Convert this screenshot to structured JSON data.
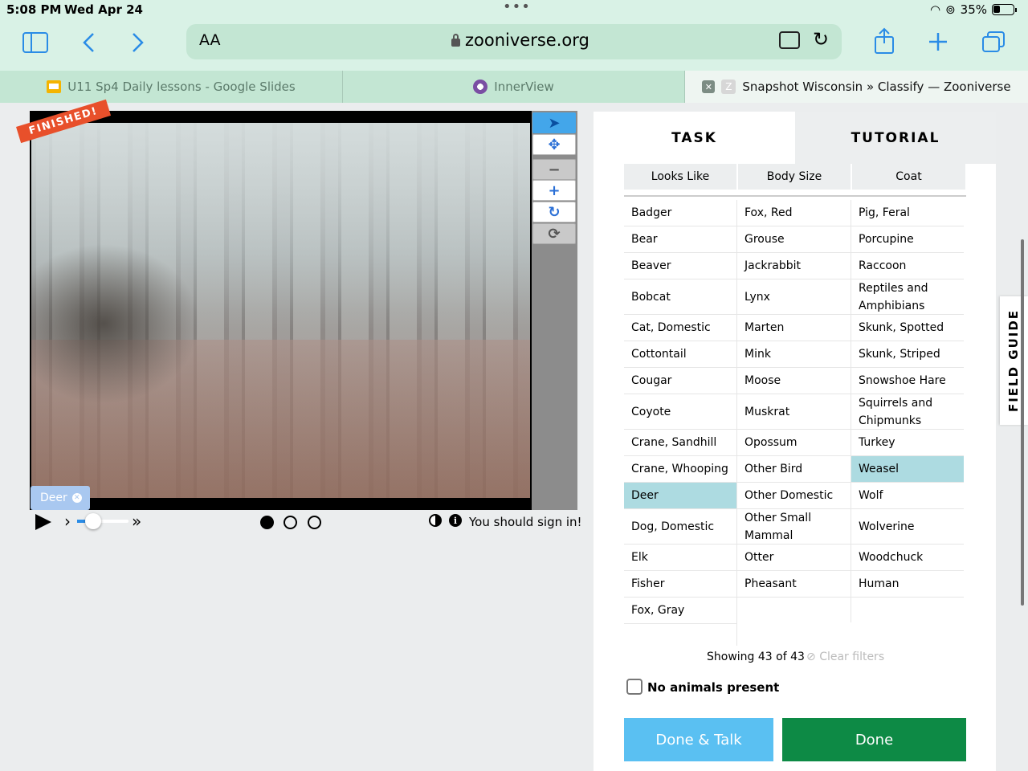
{
  "status_bar": {
    "time": "5:08 PM",
    "date": "Wed Apr 24",
    "battery": "35%"
  },
  "browser": {
    "aa_label": "AA",
    "url": "zooniverse.org",
    "tabs": [
      {
        "label": "U11 Sp4 Daily lessons - Google Slides"
      },
      {
        "label": "InnerView"
      },
      {
        "label": "Snapshot Wisconsin » Classify — Zooniverse"
      }
    ]
  },
  "viewer": {
    "finished_banner": "FINISHED!",
    "selected_chip": "Deer",
    "frame_count": 3,
    "current_frame": 1,
    "sign_in_text": "You should sign in!",
    "playback_slider": 0.2
  },
  "panel": {
    "tabs": {
      "task": "TASK",
      "tutorial": "TUTORIAL"
    },
    "filters": {
      "looks_like": "Looks Like",
      "body_size": "Body Size",
      "coat": "Coat"
    },
    "columns": [
      [
        "Badger",
        "Bear",
        "Beaver",
        "Bobcat",
        "Cat, Domestic",
        "Cottontail",
        "Cougar",
        "Coyote",
        "Crane, Sandhill",
        "Crane, Whooping",
        "Deer",
        "Dog, Domestic",
        "Elk",
        "Fisher",
        "Fox, Gray"
      ],
      [
        "Fox, Red",
        "Grouse",
        "Jackrabbit",
        "Lynx",
        "Marten",
        "Mink",
        "Moose",
        "Muskrat",
        "Opossum",
        "Other Bird",
        "Other Domestic",
        "Other Small Mammal",
        "Otter",
        "Pheasant"
      ],
      [
        "Pig, Feral",
        "Porcupine",
        "Raccoon",
        "Reptiles and Amphibians",
        "Skunk, Spotted",
        "Skunk, Striped",
        "Snowshoe Hare",
        "Squirrels and Chipmunks",
        "Turkey",
        "Weasel",
        "Wolf",
        "Wolverine",
        "Woodchuck",
        "Human"
      ]
    ],
    "selected": [
      "Deer",
      "Weasel"
    ],
    "showing_text": "Showing 43 of 43",
    "clear_filters": "Clear filters",
    "no_animals": "No animals present",
    "done_talk": "Done & Talk",
    "done": "Done",
    "field_guide": "FIELD GUIDE"
  }
}
